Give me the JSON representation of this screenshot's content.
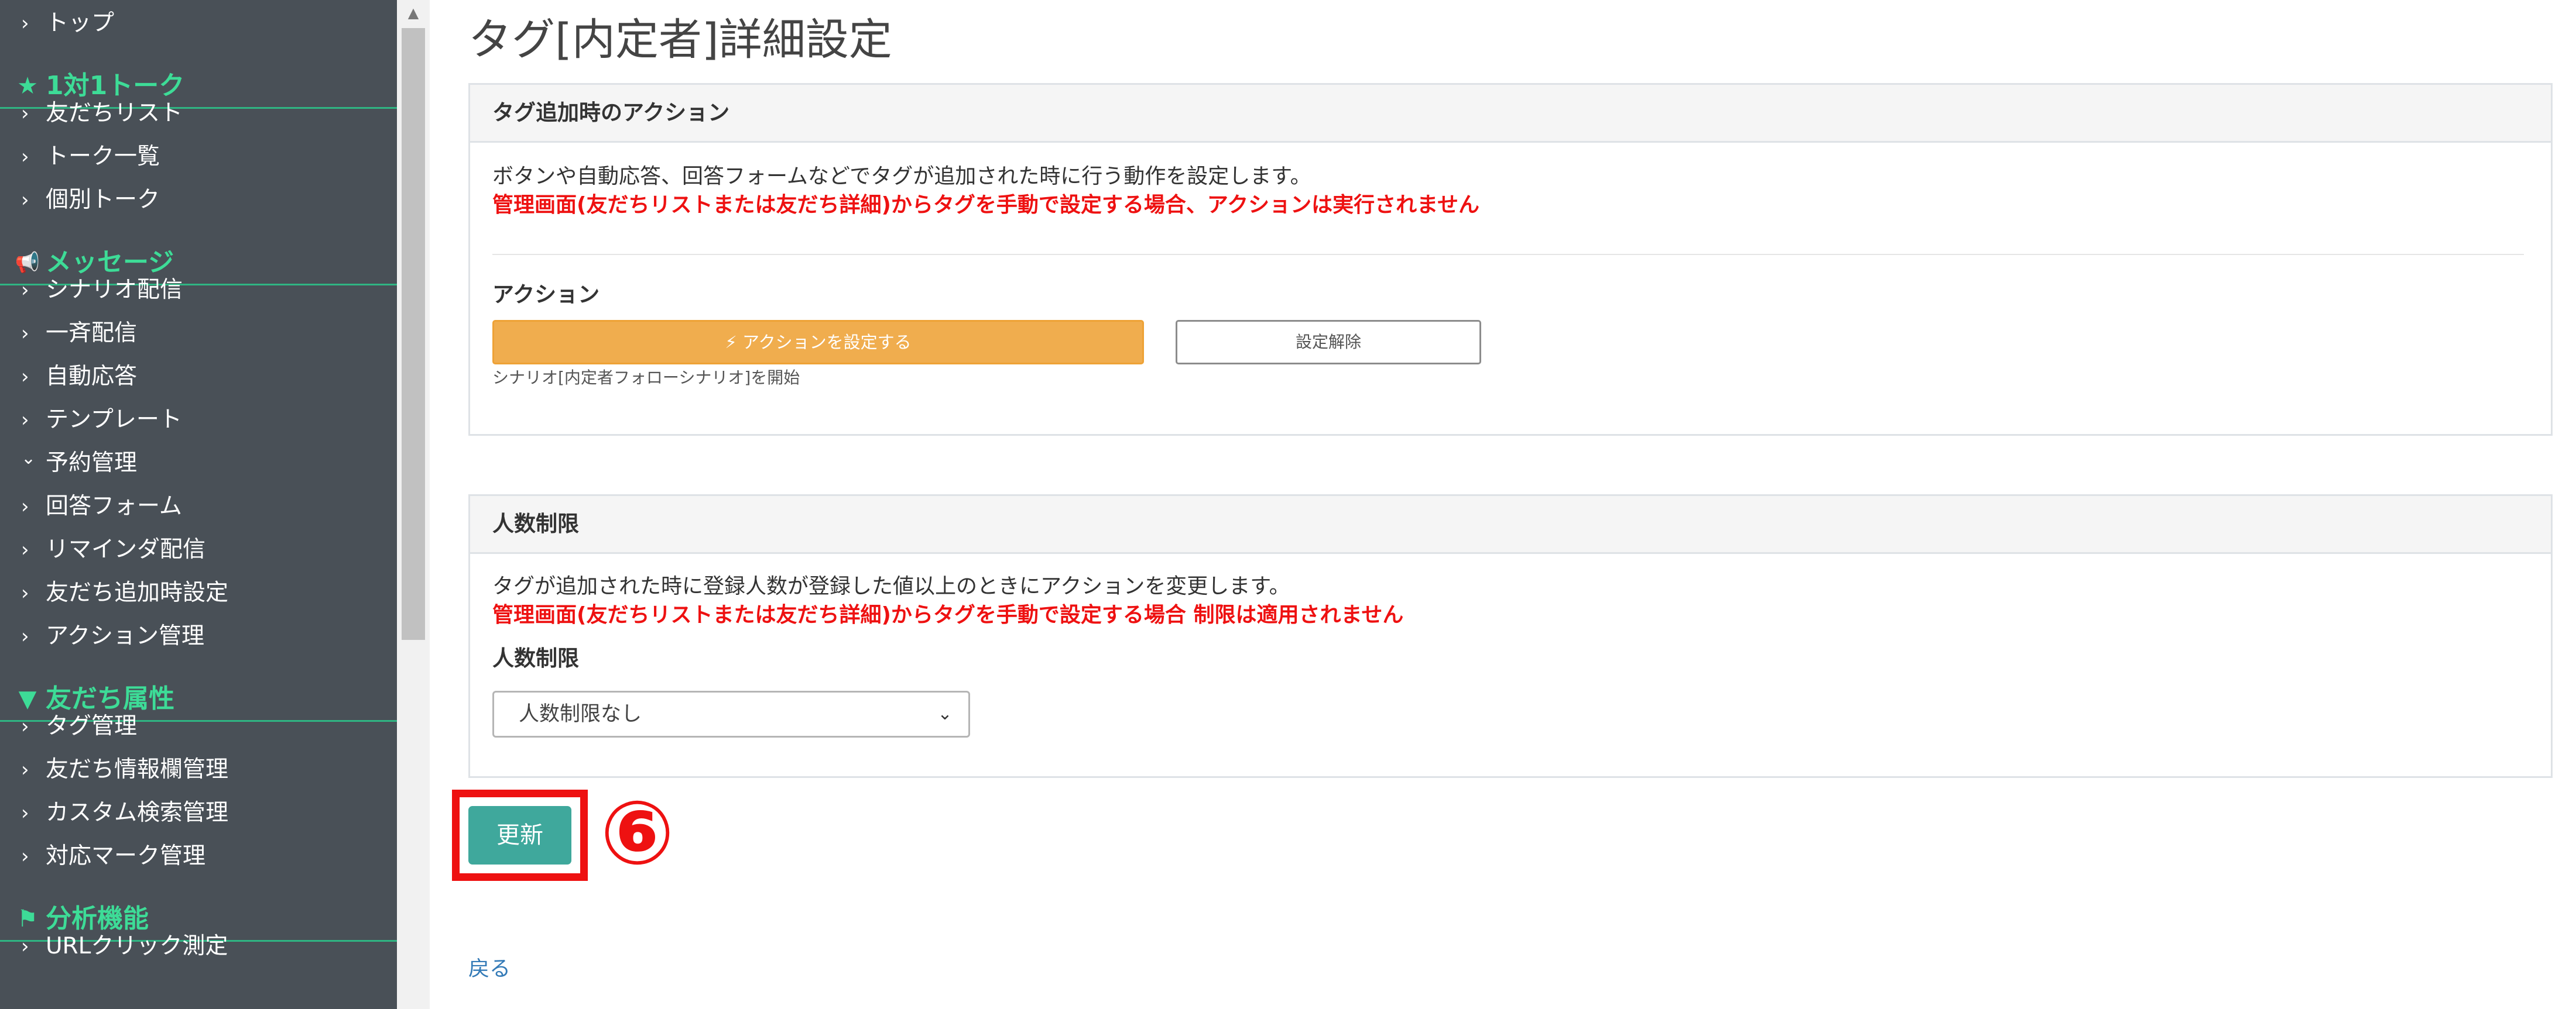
{
  "sidebar": {
    "items": [
      {
        "kind": "item",
        "icon": "chevron-right-icon",
        "label": "トップ"
      },
      {
        "kind": "head",
        "icon": "star-icon",
        "label": "1対1トーク"
      },
      {
        "kind": "item",
        "icon": "chevron-right-icon",
        "label": "友だちリスト"
      },
      {
        "kind": "item",
        "icon": "chevron-right-icon",
        "label": "トーク一覧"
      },
      {
        "kind": "item",
        "icon": "chevron-right-icon",
        "label": "個別トーク"
      },
      {
        "kind": "head",
        "icon": "megaphone-icon",
        "label": "メッセージ"
      },
      {
        "kind": "item",
        "icon": "chevron-right-icon",
        "label": "シナリオ配信"
      },
      {
        "kind": "item",
        "icon": "chevron-right-icon",
        "label": "一斉配信"
      },
      {
        "kind": "item",
        "icon": "chevron-right-icon",
        "label": "自動応答"
      },
      {
        "kind": "item",
        "icon": "chevron-right-icon",
        "label": "テンプレート"
      },
      {
        "kind": "item",
        "icon": "chevron-down-icon",
        "label": "予約管理"
      },
      {
        "kind": "item",
        "icon": "chevron-right-icon",
        "label": "回答フォーム"
      },
      {
        "kind": "item",
        "icon": "chevron-right-icon",
        "label": "リマインダ配信"
      },
      {
        "kind": "item",
        "icon": "chevron-right-icon",
        "label": "友だち追加時設定"
      },
      {
        "kind": "item",
        "icon": "chevron-right-icon",
        "label": "アクション管理"
      },
      {
        "kind": "head",
        "icon": "filter-icon",
        "label": "友だち属性"
      },
      {
        "kind": "item",
        "icon": "chevron-right-icon",
        "label": "タグ管理"
      },
      {
        "kind": "item",
        "icon": "chevron-right-icon",
        "label": "友だち情報欄管理"
      },
      {
        "kind": "item",
        "icon": "chevron-right-icon",
        "label": "カスタム検索管理"
      },
      {
        "kind": "item",
        "icon": "chevron-right-icon",
        "label": "対応マーク管理"
      },
      {
        "kind": "head",
        "icon": "flag-icon",
        "label": "分析機能"
      },
      {
        "kind": "item",
        "icon": "chevron-right-icon",
        "label": "URLクリック測定"
      }
    ]
  },
  "page": {
    "title": "タグ[内定者]詳細設定"
  },
  "action_card": {
    "title": "タグ追加時のアクション",
    "description": "ボタンや自動応答、回答フォームなどでタグが追加された時に行う動作を設定します。",
    "warning": "管理画面(友だちリストまたは友だち詳細)からタグを手動で設定する場合、アクションは実行されません",
    "action_label": "アクション",
    "set_button_label": "アクションを設定する",
    "clear_button_label": "設定解除",
    "current_action": "シナリオ[内定者フォローシナリオ]を開始"
  },
  "limit_card": {
    "title": "人数制限",
    "description": "タグが追加された時に登録人数が登録した値以上のときにアクションを変更します。",
    "warning": "管理画面(友だちリストまたは友だち詳細)からタグを手動で設定する場合 制限は適用されません",
    "limit_label": "人数制限",
    "selected_option": "人数制限なし"
  },
  "footer": {
    "update_label": "更新",
    "step_marker": "⑥",
    "back_label": "戻る"
  },
  "colors": {
    "sidebar_bg": "#495057",
    "sidebar_accent": "#3ddc97",
    "action_button": "#f0ad4e",
    "update_button": "#3fa89c",
    "warning_text": "#ee1111",
    "highlight": "#ee1111"
  }
}
